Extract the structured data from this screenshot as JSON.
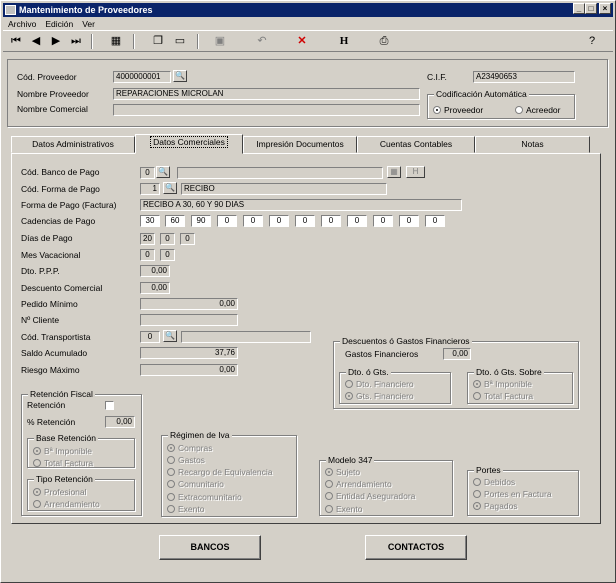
{
  "window": {
    "title": "Mantenimiento de Proveedores",
    "minimize": "_",
    "maximize": "□",
    "close": "×"
  },
  "menu": [
    "Archivo",
    "Edición",
    "Ver"
  ],
  "toolbar": [
    "first-icon",
    "prev-icon",
    "next-icon",
    "last-icon",
    "table-icon",
    "new-icon",
    "edit-icon",
    "save-icon",
    "undo-icon",
    "delete-icon",
    "history-icon",
    "print-icon",
    "help-icon"
  ],
  "header": {
    "cod_proveedor_label": "Cód. Proveedor",
    "cod_proveedor_value": "4000000001",
    "nombre_proveedor_label": "Nombre Proveedor",
    "nombre_proveedor_value": "REPARACIONES MICROLAN",
    "nombre_comercial_label": "Nombre Comercial",
    "nombre_comercial_value": "",
    "cif_label": "C.I.F.",
    "cif_value": "A23490653",
    "codificacion_title": "Codificación Automática",
    "opt_proveedor": "Proveedor",
    "opt_acreedor": "Acreedor"
  },
  "tabs": [
    "Datos Administrativos",
    "Datos Comerciales",
    "Impresión Documentos",
    "Cuentas Contables",
    "Notas"
  ],
  "form": {
    "banco_label": "Cód. Banco de Pago",
    "banco_code": "0",
    "banco_name": "",
    "forma_label": "Cód. Forma de Pago",
    "forma_code": "1",
    "forma_name": "RECIBO",
    "forma_factura_label": "Forma de Pago (Factura)",
    "forma_factura_value": "RECIBO A 30, 60 Y 90 DIAS",
    "cadencias_label": "Cadencias de Pago",
    "cadencias": [
      "30",
      "60",
      "90",
      "0",
      "0",
      "0",
      "0",
      "0",
      "0",
      "0",
      "0",
      "0"
    ],
    "dias_label": "Días de Pago",
    "dias": [
      "20",
      "0",
      "0"
    ],
    "mes_label": "Mes Vacacional",
    "mes": [
      "0",
      "0"
    ],
    "dto_ppp_label": "Dto. P.P.P.",
    "dto_ppp_value": "0,00",
    "desc_comercial_label": "Descuento Comercial",
    "desc_comercial_value": "0,00",
    "pedido_label": "Pedido Mínimo",
    "pedido_value": "0,00",
    "cliente_label": "Nº Cliente",
    "cliente_value": "",
    "transportista_label": "Cód. Transportista",
    "transportista_code": "0",
    "transportista_name": "",
    "saldo_label": "Saldo Acumulado",
    "saldo_value": "37,76",
    "riesgo_label": "Riesgo Máximo",
    "riesgo_value": "0,00"
  },
  "descuentos": {
    "title": "Descuentos ó Gastos Financieros",
    "gastos_label": "Gastos Financieros",
    "gastos_value": "0,00",
    "dto_title": "Dto. ó Gts.",
    "dto_opt1": "Dto. Financiero",
    "dto_opt2": "Gts. Financiero",
    "sobre_title": "Dto. ó Gts. Sobre",
    "sobre_opt1": "Bª Imponible",
    "sobre_opt2": "Total Factura"
  },
  "retencion": {
    "title": "Retención Fiscal",
    "ret_label": "Retención",
    "pct_label": "% Retención",
    "pct_value": "0,00",
    "base_title": "Base Retención",
    "base_opt1": "Bª Imponible",
    "base_opt2": "Total Factura",
    "tipo_title": "Tipo Retención",
    "tipo_opt1": "Profesional",
    "tipo_opt2": "Arrendamiento"
  },
  "regimen": {
    "title": "Régimen de Iva",
    "opts": [
      "Compras",
      "Gastos",
      "Recargo de Equivalencia",
      "Comunitario",
      "Extracomunitario",
      "Exento"
    ]
  },
  "modelo": {
    "title": "Modelo 347",
    "opts": [
      "Sujeto",
      "Arrendamiento",
      "Entidad Aseguradora",
      "Exento"
    ]
  },
  "portes": {
    "title": "Portes",
    "opts": [
      "Debidos",
      "Portes en Factura",
      "Pagados"
    ]
  },
  "buttons": {
    "bancos": "BANCOS",
    "contactos": "CONTACTOS"
  }
}
